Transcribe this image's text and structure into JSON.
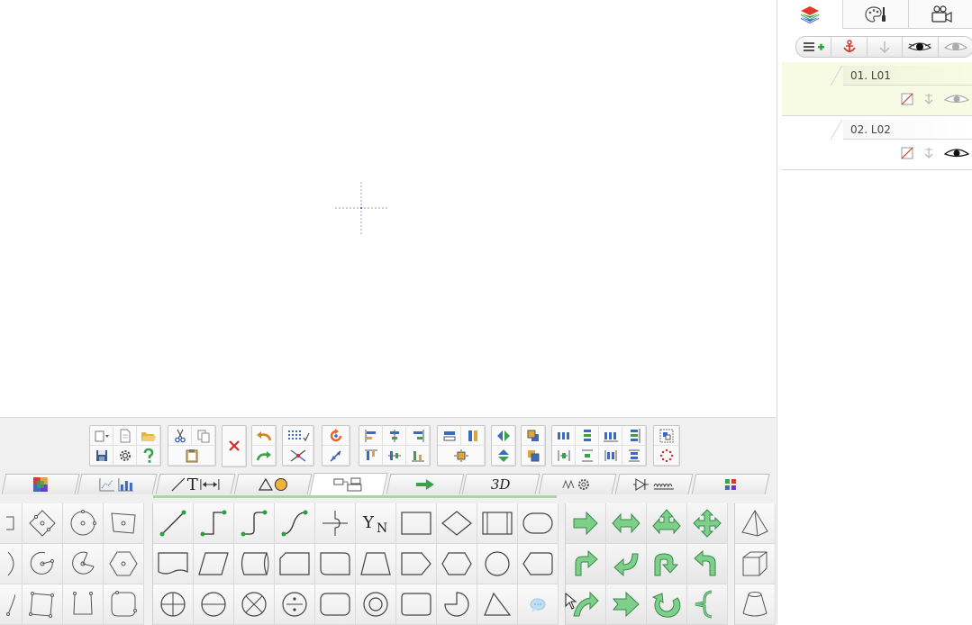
{
  "layers_panel": {
    "tabs": [
      {
        "name": "layers-icon"
      },
      {
        "name": "palette-icon"
      },
      {
        "name": "camera-icon"
      }
    ],
    "toolbar": [
      "add-layer-icon",
      "anchor-icon",
      "move-down-icon",
      "eye-icon",
      "eye-hidden-icon"
    ],
    "layers": [
      {
        "label": "01. L01",
        "selected": true,
        "visible": false
      },
      {
        "label": "02. L02",
        "selected": false,
        "visible": true
      }
    ]
  },
  "category_tabs": [
    {
      "name": "tab-colors",
      "text": ""
    },
    {
      "name": "tab-charts",
      "text": ""
    },
    {
      "name": "tab-line-text",
      "text": "T"
    },
    {
      "name": "tab-shapes",
      "text": ""
    },
    {
      "name": "tab-flowchart",
      "text": "",
      "active": true
    },
    {
      "name": "tab-arrows",
      "text": ""
    },
    {
      "name": "tab-3d",
      "text": "3D"
    },
    {
      "name": "tab-mechanical",
      "text": ""
    },
    {
      "name": "tab-electrical",
      "text": ""
    },
    {
      "name": "tab-misc",
      "text": ""
    }
  ],
  "connector_labels": {
    "yn_top": "Y",
    "yn_sub": "N"
  },
  "colors": {
    "accent_green": "#3aa24a",
    "shape_green": "#7dcf8a",
    "layer_selected_bg": "#f8fbe3",
    "delete_red": "#d62a2a",
    "undo_orange": "#d9841e"
  }
}
